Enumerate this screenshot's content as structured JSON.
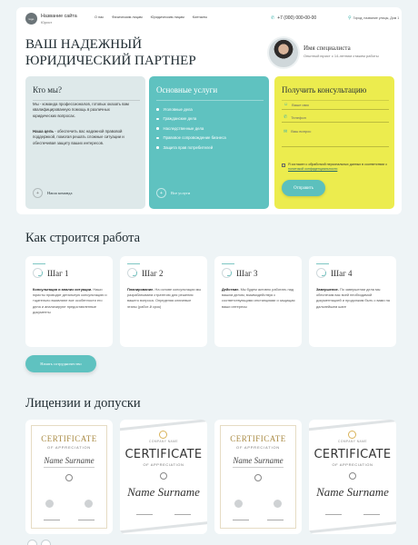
{
  "header": {
    "logo_text": "logo",
    "site_name": "Название сайта",
    "site_subtitle": "Юрист",
    "nav": [
      "О нас",
      "Физическим лицам",
      "Юридическим лицам",
      "Контакты"
    ],
    "phone": "+7 (000) 000-00-00",
    "address": "Город, название улицы, Дом 1"
  },
  "hero": {
    "title_line1": "ВАШ НАДЕЖНЫЙ",
    "title_line2": "ЮРИДИЧЕСКИЙ ПАРТНЕР",
    "specialist_name": "Имя специалиста",
    "specialist_desc": "Опытный юрист с 14-летним стажем работы"
  },
  "about": {
    "title": "Кто мы?",
    "text1": "Мы - команда профессионалов, готовых оказать вам квалифицированную помощь в различных юридических вопросах.",
    "text2_bold": "Наша цель",
    "text2": " - обеспечить вас надежной правовой поддержкой, помогая решать сложные ситуации и обеспечивая защиту ваших интересов.",
    "link": "Наша команда"
  },
  "services": {
    "title": "Основные услуги",
    "items": [
      "Уголовные дела",
      "Гражданские дела",
      "Наследственные дела",
      "Правовое сопровождение бизнеса",
      "Защита прав потребителей"
    ],
    "link": "Все услуги"
  },
  "consult": {
    "title": "Получить консультацию",
    "fields": [
      "Ваше имя",
      "Телефон",
      "Ваш вопрос"
    ],
    "consent_prefix": "Я согласен с обработкой персональных данных в соответствии с ",
    "consent_link": "политикой конфиденциальности",
    "submit": "Отправить"
  },
  "how": {
    "title": "Как строится работа",
    "steps": [
      {
        "title": "Шаг 1",
        "bold": "Консультация и анализ ситуации.",
        "text": " Наши юристы проводят детальную консультацию и тщательно выявляют все особенности его дела и анализируют предоставленные документы"
      },
      {
        "title": "Шаг 2",
        "bold": "Планирование.",
        "text": " На основе консультации мы разрабатываем стратегию для решения вашего вопроса. Определяя ключевые этапы (работ-й срок)"
      },
      {
        "title": "Шаг 3",
        "bold": "Действие.",
        "text": " Мы будем активно работать над вашим делом, взаимодействуя с соответствующими инстанциями и защищая ваши интересы"
      },
      {
        "title": "Шаг 4",
        "bold": "Завершение.",
        "text": " По завершении дела мы обеспечим вас всей необходимой документацией и продолжим быть с вами на дальнейшем шаге"
      }
    ],
    "button": "Начать сотрудничество"
  },
  "licenses": {
    "title": "Лицензии и допуски",
    "certs": [
      {
        "style": "gold",
        "heading": "CERTIFICATE",
        "sub": "OF APPRECIATION",
        "name": "Name Surname"
      },
      {
        "style": "gray",
        "company": "COMPANY NAME",
        "heading": "CERTIFICATE",
        "sub": "OF APPRECIATION",
        "name": "Name Surname"
      },
      {
        "style": "gold",
        "heading": "CERTIFICATE",
        "sub": "OF APPRECIATION",
        "name": "Name Surname"
      },
      {
        "style": "gray",
        "company": "COMPANY NAME",
        "heading": "CERTIFICATE",
        "sub": "OF APPRECIATION",
        "name": "Name Surname"
      }
    ]
  },
  "colors": {
    "teal": "#5fc2c0",
    "yellow": "#ecec4e",
    "light": "#dee9ea"
  }
}
